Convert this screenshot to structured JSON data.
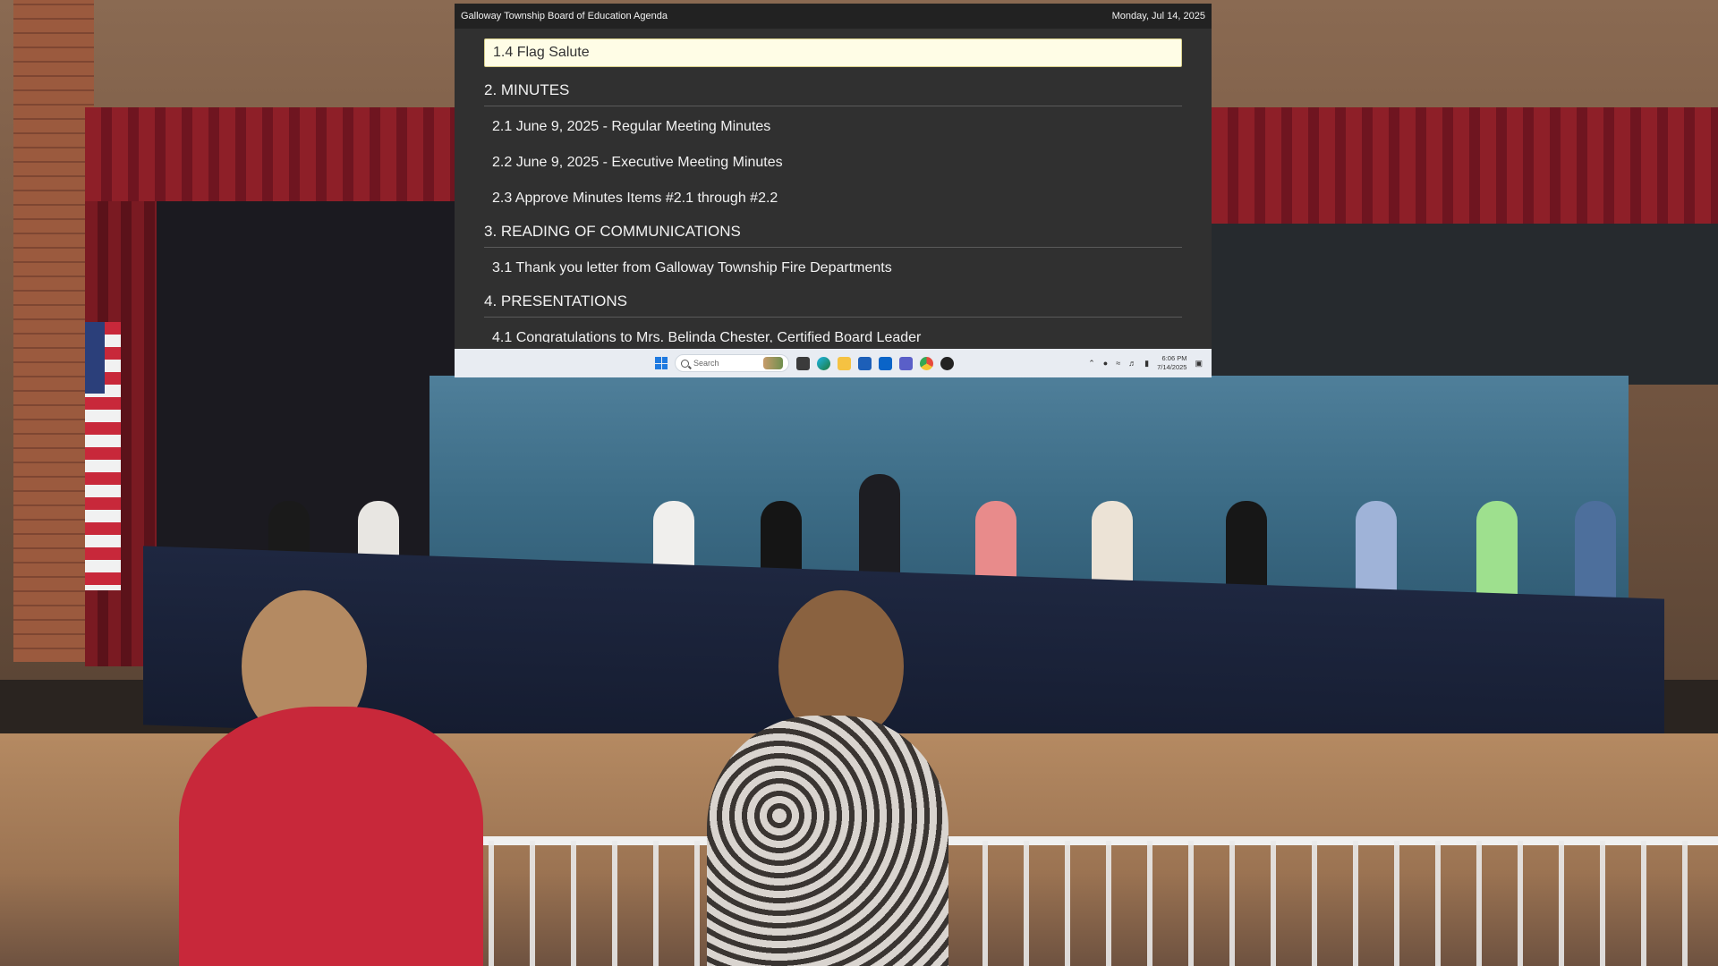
{
  "header": {
    "title": "Galloway Township Board of Education Agenda",
    "date": "Monday, Jul 14, 2025"
  },
  "agenda": {
    "current_item": "1.4 Flag Salute",
    "sections": [
      {
        "title": "2. MINUTES",
        "items": [
          "2.1 June 9, 2025 - Regular Meeting Minutes",
          "2.2 June 9, 2025 - Executive Meeting Minutes",
          "2.3 Approve Minutes Items #2.1 through #2.2"
        ]
      },
      {
        "title": "3. READING OF COMMUNICATIONS",
        "items": [
          "3.1 Thank you letter from Galloway Township Fire Departments"
        ]
      },
      {
        "title": "4. PRESENTATIONS",
        "items": [
          "4.1 Congratulations to Mrs. Belinda Chester, Certified Board Leader"
        ]
      }
    ]
  },
  "taskbar": {
    "search_placeholder": "Search",
    "time": "6:06 PM",
    "date": "7/14/2025",
    "icons": [
      "windows-start-icon",
      "search-icon",
      "file-explorer-icon",
      "edge-icon",
      "folder-icon",
      "store-icon",
      "outlook-icon",
      "teams-icon",
      "chrome-icon",
      "app-icon"
    ],
    "tray_icons": [
      "chevron-up-icon",
      "microphone-icon",
      "wifi-icon",
      "volume-icon",
      "battery-icon",
      "notification-icon"
    ]
  },
  "colors": {
    "screen_bg": "#303030",
    "header_bg": "#222222",
    "highlight_bg": "#fffde6",
    "taskbar_bg": "#e8ecf2"
  }
}
